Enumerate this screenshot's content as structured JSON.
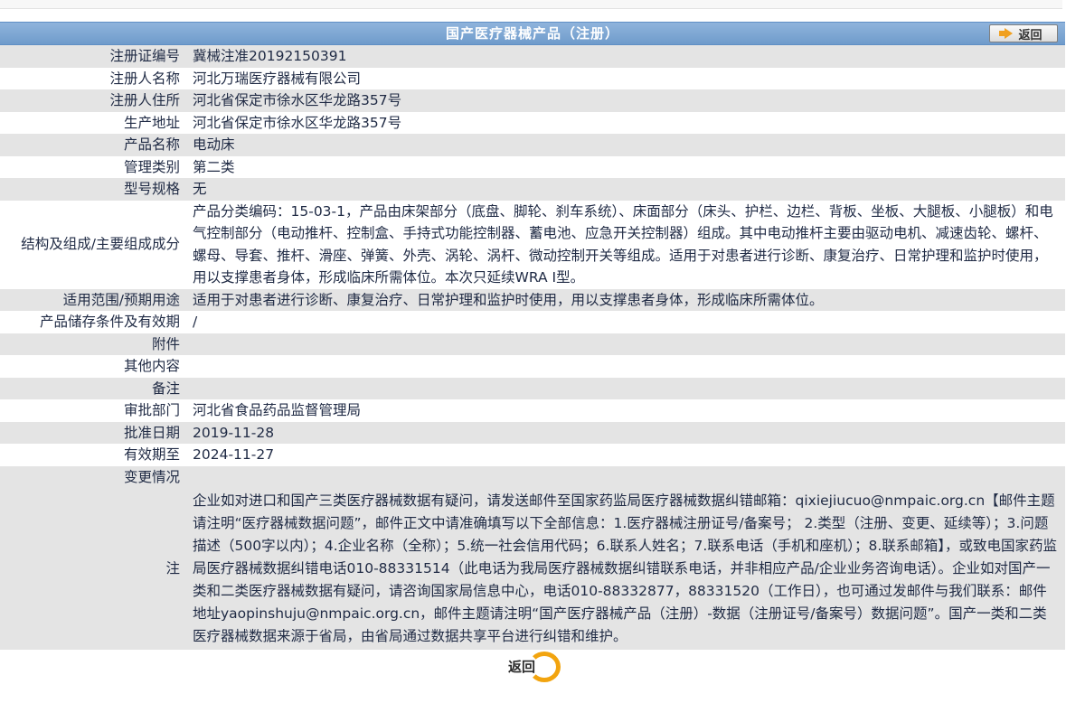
{
  "header": {
    "title": "国产医疗器械产品（注册）",
    "back_label": "返回"
  },
  "fields": [
    {
      "label": "注册证编号",
      "value": "冀械注准20192150391"
    },
    {
      "label": "注册人名称",
      "value": "河北万瑞医疗器械有限公司"
    },
    {
      "label": "注册人住所",
      "value": "河北省保定市徐水区华龙路357号"
    },
    {
      "label": "生产地址",
      "value": "河北省保定市徐水区华龙路357号"
    },
    {
      "label": "产品名称",
      "value": "电动床"
    },
    {
      "label": "管理类别",
      "value": "第二类"
    },
    {
      "label": "型号规格",
      "value": "无"
    },
    {
      "label": "结构及组成/主要组成成分",
      "value": "产品分类编码：15-03-1，产品由床架部分（底盘、脚轮、刹车系统）、床面部分（床头、护栏、边栏、背板、坐板、大腿板、小腿板）和电气控制部分（电动推杆、控制盒、手持式功能控制器、蓄电池、应急开关控制器）组成。其中电动推杆主要由驱动电机、减速齿轮、螺杆、螺母、导套、推杆、滑座、弹簧、外壳、涡轮、涡杆、微动控制开关等组成。适用于对患者进行诊断、康复治疗、日常护理和监护时使用，用以支撑患者身体，形成临床所需体位。本次只延续WRA I型。"
    },
    {
      "label": "适用范围/预期用途",
      "value": "适用于对患者进行诊断、康复治疗、日常护理和监护时使用，用以支撑患者身体，形成临床所需体位。"
    },
    {
      "label": "产品储存条件及有效期",
      "value": "/"
    },
    {
      "label": "附件",
      "value": ""
    },
    {
      "label": "其他内容",
      "value": ""
    },
    {
      "label": "备注",
      "value": ""
    },
    {
      "label": "审批部门",
      "value": "河北省食品药品监督管理局"
    },
    {
      "label": "批准日期",
      "value": "2019-11-28"
    },
    {
      "label": "有效期至",
      "value": "2024-11-27"
    },
    {
      "label": "变更情况",
      "value": ""
    }
  ],
  "notice": {
    "label": "注",
    "text": "企业如对进口和国产三类医疗器械数据有疑问，请发送邮件至国家药监局医疗器械数据纠错邮箱：qixiejiucuo@nmpaic.org.cn【邮件主题请注明“医疗器械数据问题”，邮件正文中请准确填写以下全部信息：1.医疗器械注册证号/备案号； 2.类型（注册、变更、延续等）；3.问题描述（500字以内）；4.企业名称（全称）；5.统一社会信用代码；6.联系人姓名；7.联系电话（手机和座机）；8.联系邮箱】，或致电国家药监局医疗器械数据纠错电话010-88331514（此电话为我局医疗器械数据纠错联系电话，并非相应产品/企业业务咨询电话）。企业如对国产一类和二类医疗器械数据有疑问，请咨询国家局信息中心，电话010-88332877，88331520（工作日），也可通过发邮件与我们联系：邮件地址yaopinshuju@nmpaic.org.cn，邮件主题请注明“国产医疗器械产品（注册）-数据（注册证号/备案号）数据问题”。国产一类和二类医疗器械数据来源于省局，由省局通过数据共享平台进行纠错和维护。"
  },
  "footer": {
    "back_label": "返回"
  },
  "colors": {
    "title_bar": "#7aa3d1",
    "row_alt": "#e4e4e4",
    "accent_orange": "#f2a40f"
  }
}
